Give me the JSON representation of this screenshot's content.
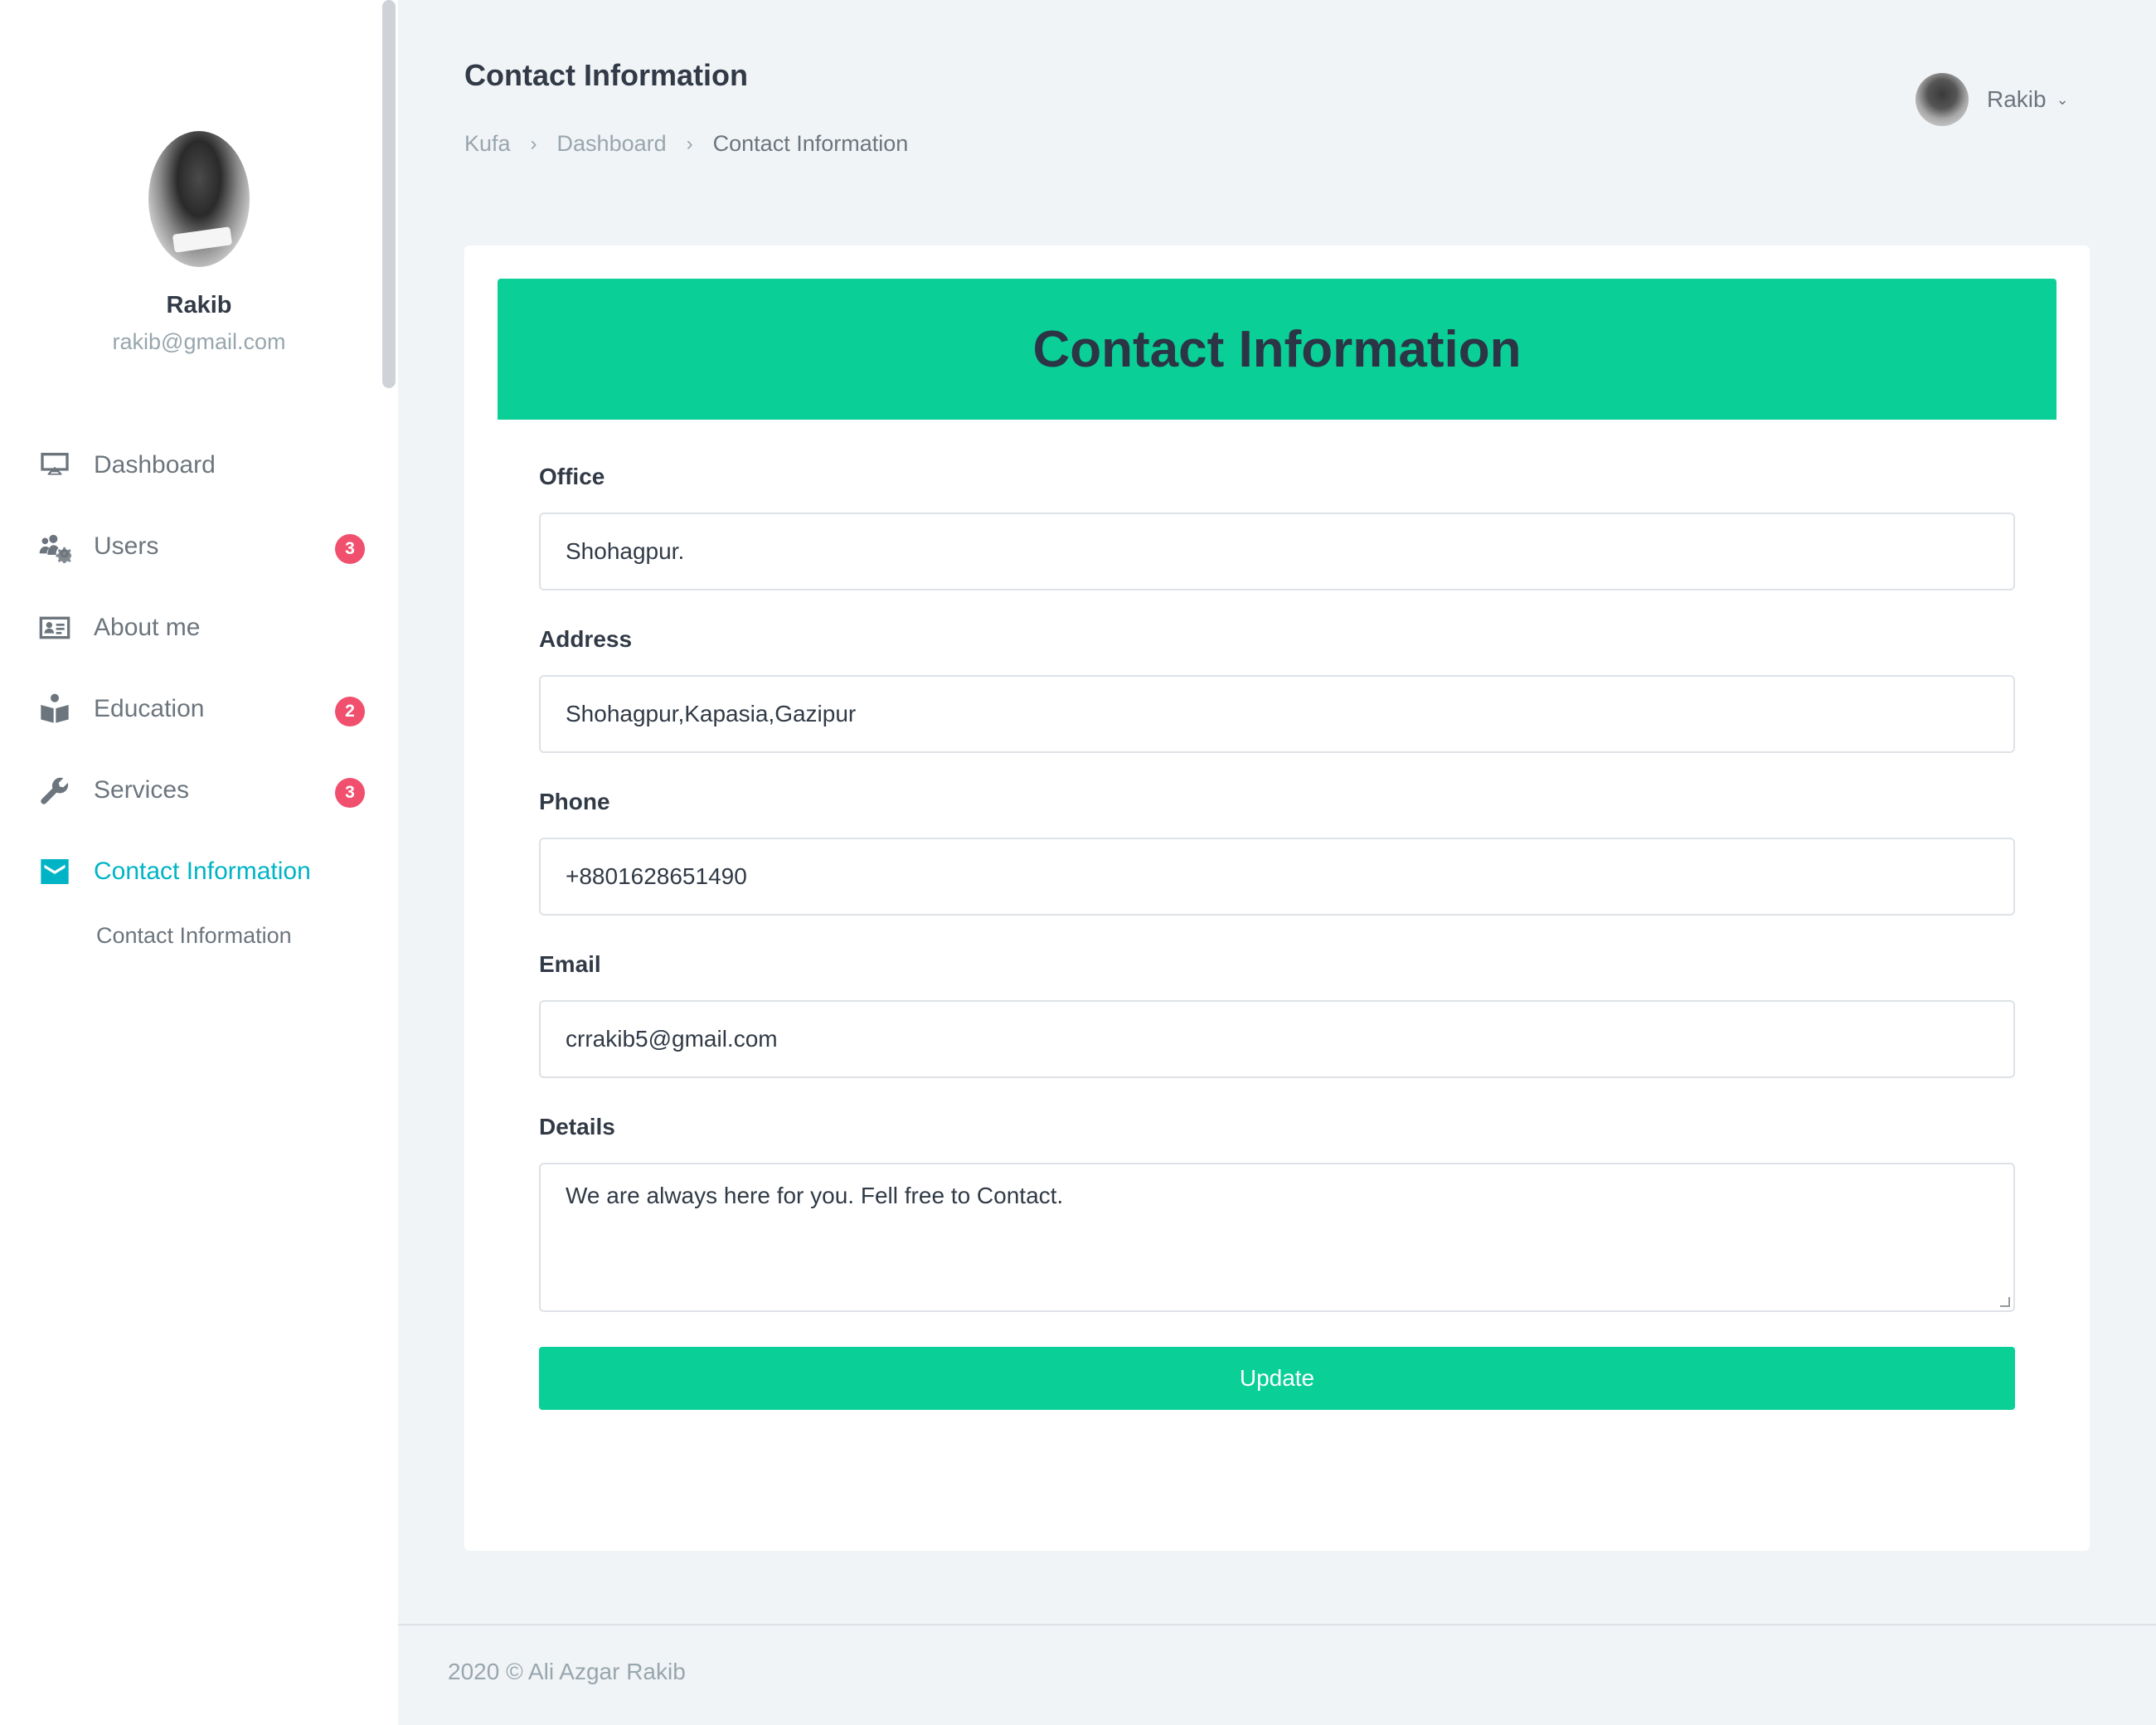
{
  "sidebar": {
    "profile": {
      "name": "Rakib",
      "email": "rakib@gmail.com"
    },
    "items": [
      {
        "label": "Dashboard",
        "icon": "monitor-icon",
        "badge": null
      },
      {
        "label": "Users",
        "icon": "users-gear-icon",
        "badge": "3"
      },
      {
        "label": "About me",
        "icon": "id-card-icon",
        "badge": null
      },
      {
        "label": "Education",
        "icon": "reader-icon",
        "badge": "2"
      },
      {
        "label": "Services",
        "icon": "wrench-icon",
        "badge": "3"
      },
      {
        "label": "Contact Information",
        "icon": "envelope-icon",
        "badge": null,
        "active": true
      }
    ],
    "subitems": [
      {
        "label": "Contact Information"
      }
    ],
    "active_color": "#00b4c5",
    "badge_color": "#f0506e"
  },
  "header": {
    "title": "Contact Information",
    "breadcrumb": [
      "Kufa",
      "Dashboard",
      "Contact Information"
    ],
    "user": {
      "name": "Rakib"
    }
  },
  "card": {
    "title": "Contact Information",
    "header_color": "#0acf97",
    "fields": {
      "office": {
        "label": "Office",
        "value": "Shohagpur."
      },
      "address": {
        "label": "Address",
        "value": "Shohagpur,Kapasia,Gazipur"
      },
      "phone": {
        "label": "Phone",
        "value": "+8801628651490"
      },
      "email": {
        "label": "Email",
        "value": "crrakib5@gmail.com"
      },
      "details": {
        "label": "Details",
        "value": "We are always here for you. Fell free to Contact."
      }
    },
    "submit_label": "Update"
  },
  "footer": {
    "text": "2020 © Ali Azgar Rakib"
  }
}
